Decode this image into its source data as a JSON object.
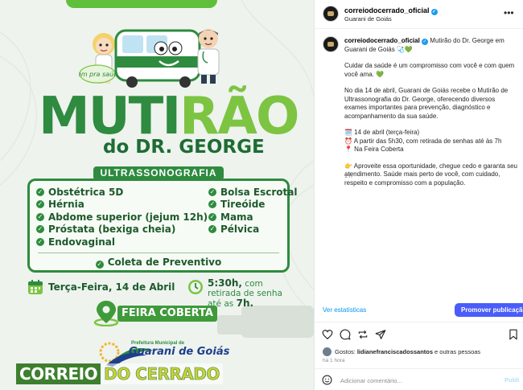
{
  "poster": {
    "badge_text": "Vem pra saúde",
    "title_main": "MUTIRÃO",
    "title_sub": "do DR. GEORGE",
    "section_title": "ULTRASSONOGRAFIA",
    "exams_left": [
      "Obstétrica 5D",
      "Hérnia",
      "Abdome superior (jejum 12h)",
      "Próstata (bexiga cheia)",
      "Endovaginal"
    ],
    "exams_right": [
      "Bolsa Escrotal",
      "Tireóide",
      "Mama",
      "Pélvica"
    ],
    "extra_exam": "Coleta de Preventivo",
    "date_text": "Terça-Feira, 14 de Abril",
    "time_bold": "5:30h,",
    "time_rest": "com retirada de senha até as",
    "time_end": "7h.",
    "location": "FEIRA COBERTA",
    "prefeitura_small": "Prefeitura Municipal de",
    "prefeitura_name": "Guarani de Goiás",
    "watermark_a": "CORREIO",
    "watermark_b": "DO CERRADO",
    "colors": {
      "green_dark": "#1d5a2c",
      "green": "#2e8b3f",
      "green_light": "#7cc442",
      "blue": "#1e3f8c"
    }
  },
  "panel": {
    "header": {
      "username": "correiodocerrado_oficial",
      "location": "Guarani de Goiás",
      "more_icon": "more-horizontal-icon"
    },
    "caption": {
      "username": "correiodocerrado_oficial",
      "title": "Mutirão do Dr. George em Guarani de Goiás 🩺💚",
      "para1": "Cuidar da saúde é um compromisso com você e com quem você ama. 💚",
      "para2": "No dia 14 de abril, Guarani de Goiás recebe o Mutirão de Ultrassonografia do Dr. George, oferecendo diversos exames importantes para prevenção, diagnóstico e acompanhamento da sua saúde.",
      "line_date": "🗓️ 14 de abril (terça-feira)",
      "line_time": "⏰ A partir das 5h30, com retirada de senhas até às 7h",
      "line_place": "📍 Na Feira Coberta",
      "para4": "👉 Aproveite essa oportunidade, chegue cedo e garanta seu atendimento. Saúde mais perto de você, com cuidado, respeito e compromisso com a população.",
      "time": "1 h"
    },
    "stats_link": "Ver estatísticas",
    "promote_button": "Promover publicação",
    "likes_prefix": "Gostos:",
    "likes_user": "lidianefranciscadossantos",
    "likes_suffix": "e outras pessoas",
    "post_time": "há 1 hora",
    "comment_placeholder": "Adicionar comentário...",
    "publish_button": "Publi"
  }
}
